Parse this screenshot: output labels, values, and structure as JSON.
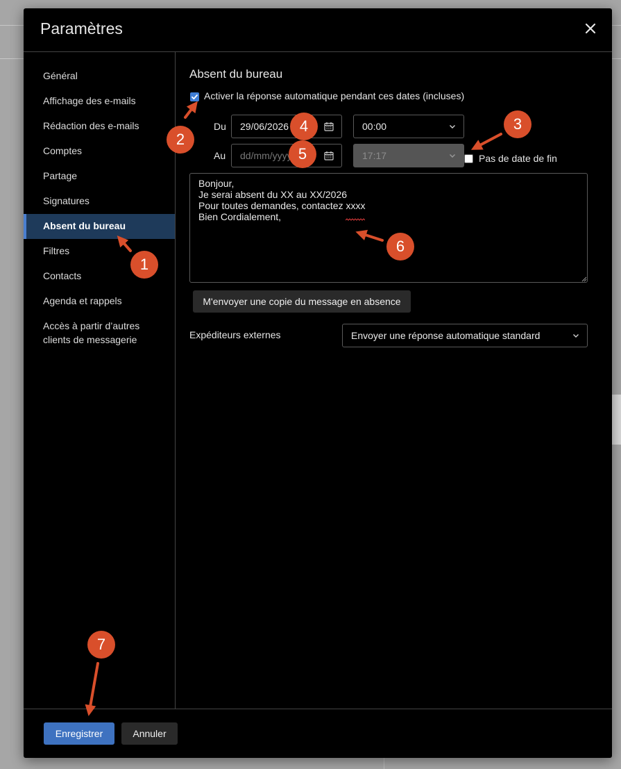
{
  "dialog": {
    "title": "Paramètres"
  },
  "sidebar": {
    "items": [
      {
        "label": "Général"
      },
      {
        "label": "Affichage des e-mails"
      },
      {
        "label": "Rédaction des e-mails"
      },
      {
        "label": "Comptes"
      },
      {
        "label": "Partage"
      },
      {
        "label": "Signatures"
      },
      {
        "label": "Absent du bureau",
        "active": true
      },
      {
        "label": "Filtres"
      },
      {
        "label": "Contacts"
      },
      {
        "label": "Agenda et rappels"
      },
      {
        "label": "Accès à partir d’autres clients de messagerie"
      }
    ]
  },
  "ooo": {
    "title": "Absent du bureau",
    "enable_label": "Activer la réponse automatique pendant ces dates (incluses)",
    "enable_checked": true,
    "from_label": "Du",
    "from_date": "29/06/2026",
    "from_time": "00:00",
    "to_label": "Au",
    "to_date_placeholder": "dd/mm/yyyy",
    "to_time": "17:17",
    "no_end_label": "Pas de date de fin",
    "no_end_checked": false,
    "message": "Bonjour,\nJe serai absent du XX au XX/2026\nPour toutes demandes, contactez xxxx\nBien Cordialement,",
    "send_copy_label": "M'envoyer une copie du message en absence",
    "external_label": "Expéditeurs externes",
    "external_value": "Envoyer une réponse automatique standard"
  },
  "footer": {
    "save_label": "Enregistrer",
    "cancel_label": "Annuler"
  },
  "annotations": {
    "badges": [
      "1",
      "2",
      "3",
      "4",
      "5",
      "6",
      "7"
    ],
    "color": "#d94f2b"
  },
  "colors": {
    "accent": "#3e72c0",
    "active_nav": "#1e3a5a",
    "badge": "#d94f2b"
  },
  "icons": [
    "close-icon",
    "calendar-icon",
    "chevron-down-icon",
    "check-icon"
  ]
}
